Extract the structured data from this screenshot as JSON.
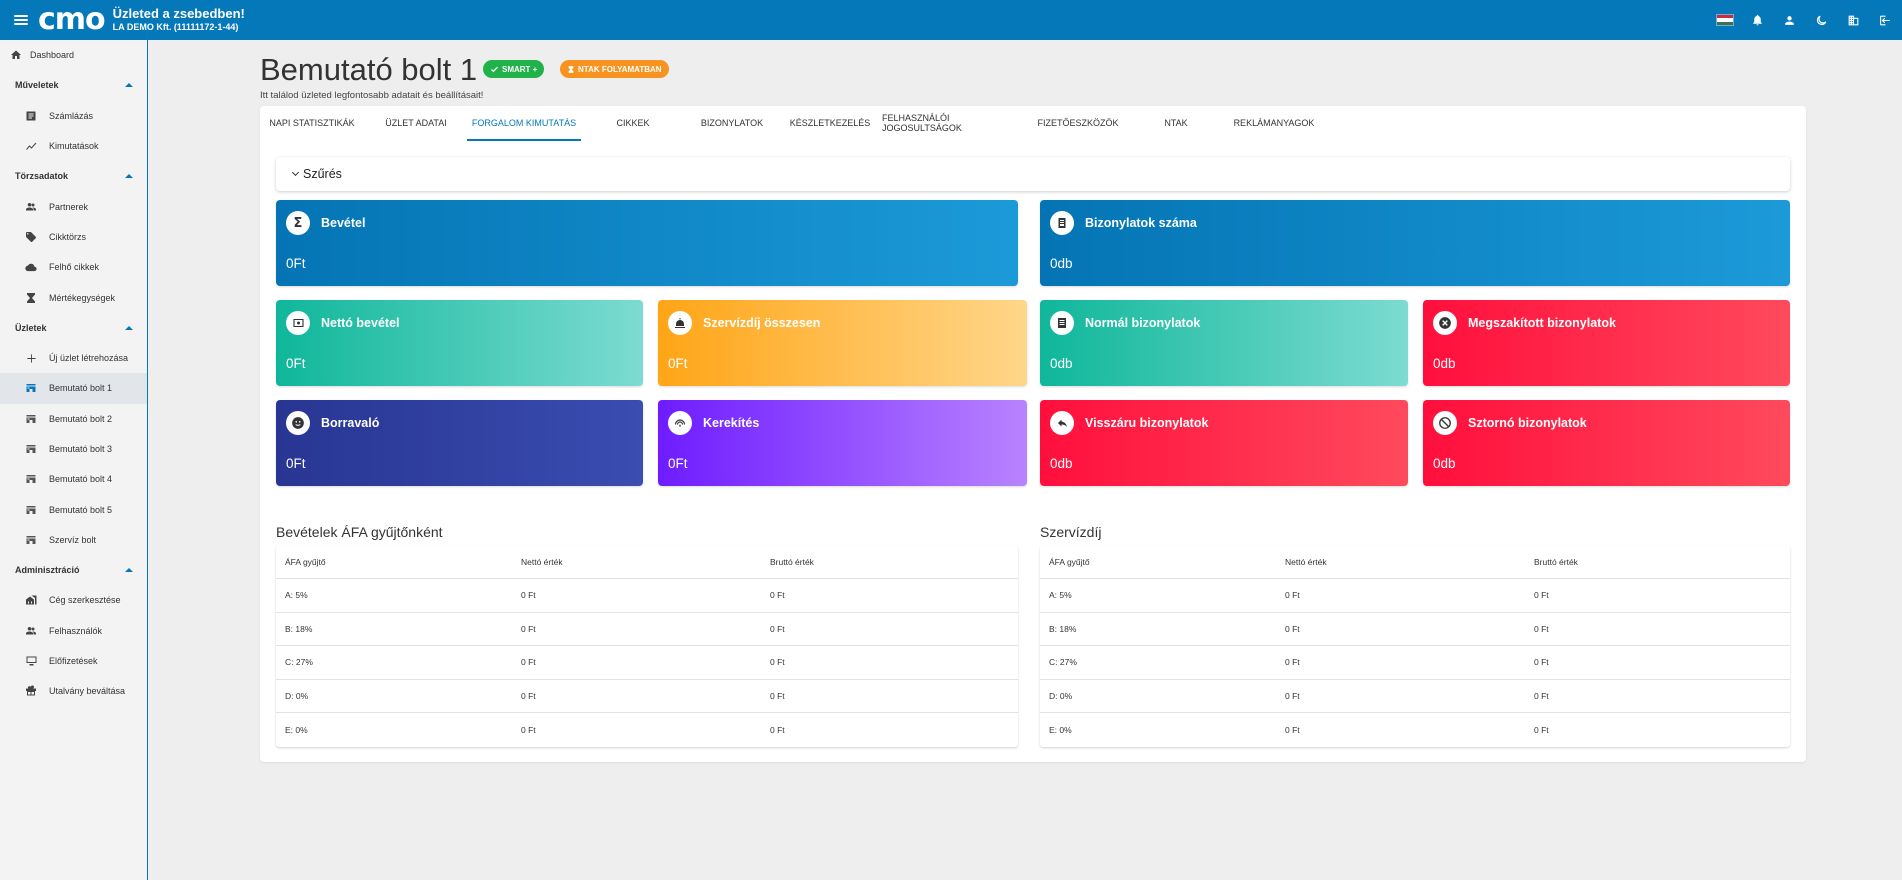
{
  "topbar": {
    "logo": "cmo",
    "title": "Üzleted a zsebedben!",
    "company": "LA DEMO Kft. (11111172-1-44)",
    "icons": [
      "hungarian-flag-icon",
      "bell-icon",
      "user-icon",
      "dark-mode-icon",
      "building-icon",
      "logout-icon"
    ]
  },
  "sidebar": {
    "dashboard": "Dashboard",
    "sections": [
      {
        "title": "Műveletek",
        "items": [
          {
            "label": "Számlázás",
            "icon": "invoice-icon"
          },
          {
            "label": "Kimutatások",
            "icon": "trend-icon"
          }
        ]
      },
      {
        "title": "Törzsadatok",
        "items": [
          {
            "label": "Partnerek",
            "icon": "people-icon"
          },
          {
            "label": "Cikktörzs",
            "icon": "tag-icon"
          },
          {
            "label": "Felhő cikkek",
            "icon": "cloud-icon"
          },
          {
            "label": "Mértékegységek",
            "icon": "scale-icon"
          }
        ]
      },
      {
        "title": "Üzletek",
        "items": [
          {
            "label": "Új üzlet létrehozása",
            "icon": "plus-icon"
          },
          {
            "label": "Bemutató bolt 1",
            "icon": "store-icon"
          },
          {
            "label": "Bemutató bolt 2",
            "icon": "store-icon"
          },
          {
            "label": "Bemutató bolt 3",
            "icon": "store-icon"
          },
          {
            "label": "Bemutató bolt 4",
            "icon": "store-icon"
          },
          {
            "label": "Bemutató bolt 5",
            "icon": "store-icon"
          },
          {
            "label": "Szervíz bolt",
            "icon": "store-icon"
          }
        ]
      },
      {
        "title": "Adminisztráció",
        "items": [
          {
            "label": "Cég szerkesztése",
            "icon": "company-icon"
          },
          {
            "label": "Felhasználók",
            "icon": "people-icon"
          },
          {
            "label": "Előfizetések",
            "icon": "monitor-icon"
          },
          {
            "label": "Utalvány beváltása",
            "icon": "gift-icon"
          }
        ]
      }
    ]
  },
  "page": {
    "title": "Bemutató bolt 1",
    "badge_smart": "SMART +",
    "badge_ntak": "NTAK FOLYAMATBAN",
    "subtitle": "Itt találod üzleted legfontosabb adatait és beállításait!"
  },
  "tabs": [
    "NAPI STATISZTIKÁK",
    "ÜZLET ADATAI",
    "FORGALOM KIMUTATÁS",
    "CIKKEK",
    "BIZONYLATOK",
    "KÉSZLETKEZELÉS",
    "FELHASZNÁLÓI JOGOSULTSÁGOK",
    "FIZETŐESZKÖZÖK",
    "NTAK",
    "REKLÁMANYAGOK"
  ],
  "active_tab": "FORGALOM KIMUTATÁS",
  "filter": {
    "label": "Szűrés"
  },
  "tiles": {
    "bevetel": {
      "label": "Bevétel",
      "value": "0Ft",
      "icon": "sigma-icon",
      "color": "#0b7fc0"
    },
    "bizonylatok_szama": {
      "label": "Bizonylatok száma",
      "value": "0db",
      "icon": "receipt-icon",
      "color": "#0b7fc0"
    },
    "netto_bevetel": {
      "label": "Nettó bevétel",
      "value": "0Ft",
      "icon": "cash-icon",
      "color": "#1cbfa4"
    },
    "szervizdij": {
      "label": "Szervízdíj összesen",
      "value": "0Ft",
      "icon": "service-icon",
      "color": "#ffab1a"
    },
    "normal_bizonylatok": {
      "label": "Normál bizonylatok",
      "value": "0db",
      "icon": "document-icon",
      "color": "#1cbfa4"
    },
    "megszakitott": {
      "label": "Megszakított bizonylatok",
      "value": "0db",
      "icon": "cancel-circle-icon",
      "color": "#ff1a47"
    },
    "borravalo": {
      "label": "Borravaló",
      "value": "0Ft",
      "icon": "smiley-icon",
      "color": "#2e3a96"
    },
    "kerekites": {
      "label": "Kerekítés",
      "value": "0Ft",
      "icon": "rounding-icon",
      "color": "#7a2cff"
    },
    "visszaru": {
      "label": "Visszáru bizonylatok",
      "value": "0db",
      "icon": "return-icon",
      "color": "#ff1a47"
    },
    "sztorno": {
      "label": "Sztornó bizonylatok",
      "value": "0db",
      "icon": "block-icon",
      "color": "#ff1a47"
    }
  },
  "afa_table": {
    "title": "Bevételek ÁFA gyűjtőnként",
    "headers": [
      "ÁFA gyűjtő",
      "Nettó érték",
      "Bruttó érték"
    ],
    "rows": [
      [
        "A: 5%",
        "0 Ft",
        "0 Ft"
      ],
      [
        "B: 18%",
        "0 Ft",
        "0 Ft"
      ],
      [
        "C: 27%",
        "0 Ft",
        "0 Ft"
      ],
      [
        "D: 0%",
        "0 Ft",
        "0 Ft"
      ],
      [
        "E: 0%",
        "0 Ft",
        "0 Ft"
      ]
    ]
  },
  "szervizdij_table": {
    "title": "Szervízdíj",
    "headers": [
      "ÁFA gyűjtő",
      "Nettó érték",
      "Bruttó érték"
    ],
    "rows": [
      [
        "A: 5%",
        "0 Ft",
        "0 Ft"
      ],
      [
        "B: 18%",
        "0 Ft",
        "0 Ft"
      ],
      [
        "C: 27%",
        "0 Ft",
        "0 Ft"
      ],
      [
        "D: 0%",
        "0 Ft",
        "0 Ft"
      ],
      [
        "E: 0%",
        "0 Ft",
        "0 Ft"
      ]
    ]
  }
}
